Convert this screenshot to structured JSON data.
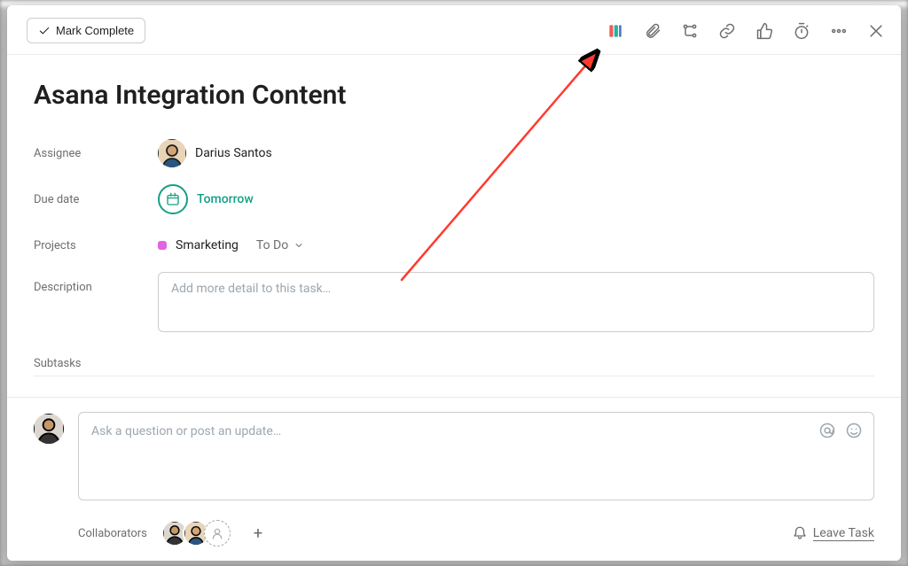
{
  "header": {
    "markComplete": "Mark Complete"
  },
  "task": {
    "title": "Asana Integration Content",
    "assigneeLabel": "Assignee",
    "assigneeName": "Darius Santos",
    "dueDateLabel": "Due date",
    "dueDateValue": "Tomorrow",
    "projectsLabel": "Projects",
    "projectName": "Smarketing",
    "projectSection": "To Do",
    "projectColor": "#e362e3",
    "descriptionLabel": "Description",
    "descriptionPlaceholder": "Add more detail to this task…",
    "subtasksLabel": "Subtasks"
  },
  "comment": {
    "placeholder": "Ask a question or post an update…"
  },
  "footer": {
    "collaboratorsLabel": "Collaborators",
    "leaveTask": "Leave Task"
  }
}
